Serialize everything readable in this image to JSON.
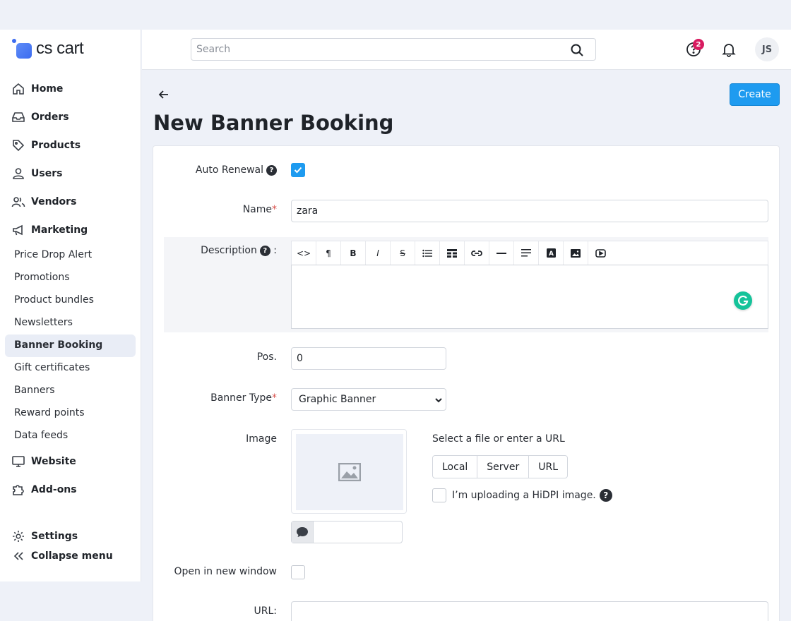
{
  "brand": {
    "name": "cs cart"
  },
  "nav": {
    "main": [
      {
        "label": "Home",
        "icon": "home-icon"
      },
      {
        "label": "Orders",
        "icon": "inbox-icon"
      },
      {
        "label": "Products",
        "icon": "tag-icon"
      },
      {
        "label": "Users",
        "icon": "user-icon"
      },
      {
        "label": "Vendors",
        "icon": "users-icon"
      },
      {
        "label": "Marketing",
        "icon": "megaphone-icon"
      }
    ],
    "marketing_items": [
      "Price Drop Alert",
      "Promotions",
      "Product bundles",
      "Newsletters",
      "Banner Booking",
      "Gift certificates",
      "Banners",
      "Reward points",
      "Data feeds"
    ],
    "active_item": "Banner Booking",
    "website": "Website",
    "addons": "Add-ons",
    "settings": "Settings",
    "collapse": "Collapse menu"
  },
  "topbar": {
    "search_placeholder": "Search",
    "notifications_count": "2",
    "avatar_initials": "JS"
  },
  "page": {
    "title": "New Banner Booking",
    "create_label": "Create"
  },
  "form": {
    "auto_renewal": {
      "label": "Auto Renewal",
      "checked": true
    },
    "name": {
      "label": "Name",
      "value": "zara"
    },
    "description": {
      "label": "Description",
      "colon": ":"
    },
    "position": {
      "label": "Pos.",
      "value": "0"
    },
    "banner_type": {
      "label": "Banner Type",
      "value": "Graphic Banner"
    },
    "image": {
      "label": "Image",
      "hint": "Select a file or enter a URL",
      "sources": [
        "Local",
        "Server",
        "URL"
      ],
      "hidpi_label": "I’m uploading a HiDPI image."
    },
    "open_new_window": {
      "label": "Open in new window",
      "checked": false
    },
    "url": {
      "label": "URL:"
    }
  },
  "colors": {
    "accent": "#1e9bf0",
    "badge": "#d81b60",
    "required": "#d9534f"
  }
}
